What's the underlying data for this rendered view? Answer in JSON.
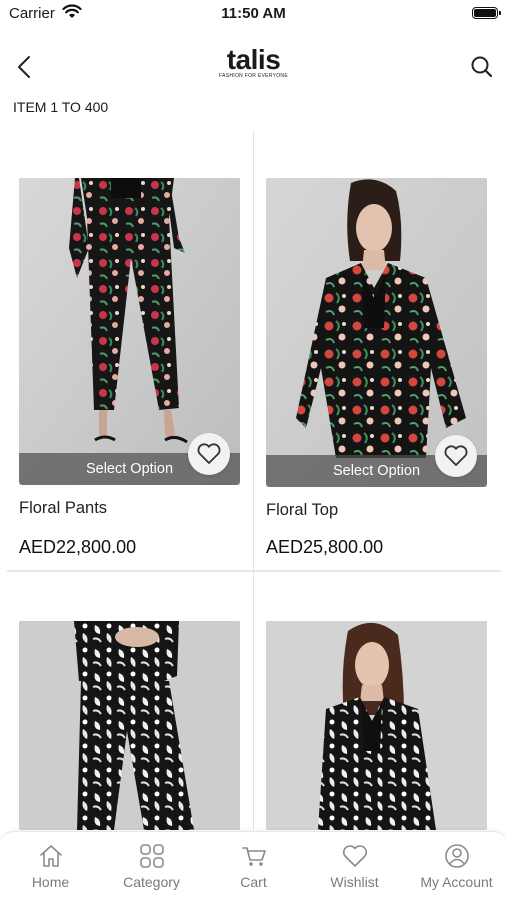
{
  "status_bar": {
    "carrier": "Carrier",
    "time": "11:50 AM"
  },
  "header": {
    "logo": "talis",
    "tagline": "FASHION FOR EVERYONE"
  },
  "listing": {
    "item_count": "ITEM 1 TO 400"
  },
  "products": [
    {
      "name": "Floral Pants",
      "price": "AED22,800.00",
      "action": "Select Option"
    },
    {
      "name": "Floral Top",
      "price": "AED25,800.00",
      "action": "Select Option"
    },
    {
      "name": "",
      "price": "",
      "action": ""
    },
    {
      "name": "",
      "price": "",
      "action": ""
    }
  ],
  "tabs": [
    {
      "label": "Home",
      "icon": "home-icon"
    },
    {
      "label": "Category",
      "icon": "category-icon"
    },
    {
      "label": "Cart",
      "icon": "cart-icon"
    },
    {
      "label": "Wishlist",
      "icon": "heart-icon"
    },
    {
      "label": "My Account",
      "icon": "account-icon"
    }
  ]
}
